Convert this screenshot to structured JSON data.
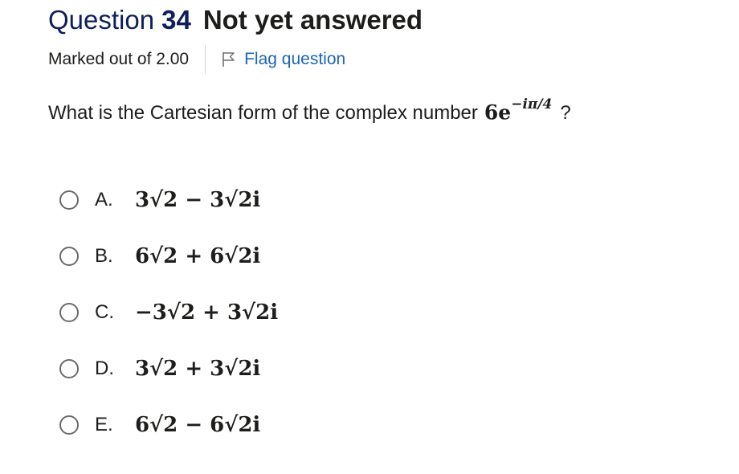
{
  "question": {
    "label": "Question",
    "number": "34",
    "state": "Not yet answered",
    "marked_out_of": "Marked out of 2.00",
    "flag_label": "Flag question",
    "text": "What is the Cartesian form of the complex number",
    "expression_base": "6e",
    "expression_exponent": "−iπ/4",
    "question_mark": "?"
  },
  "options": [
    {
      "letter": "A.",
      "answer": "3√2 − 3√2i"
    },
    {
      "letter": "B.",
      "answer": "6√2 + 6√2i"
    },
    {
      "letter": "C.",
      "answer": "−3√2 + 3√2i"
    },
    {
      "letter": "D.",
      "answer": "3√2 + 3√2i"
    },
    {
      "letter": "E.",
      "answer": "6√2 − 6√2i"
    }
  ],
  "colors": {
    "heading": "#0f1f5c",
    "link": "#1d64b6",
    "text": "#1d1d1b"
  },
  "icons": {
    "flag": "flag-outline-icon",
    "radio": "radio-unchecked-icon"
  }
}
